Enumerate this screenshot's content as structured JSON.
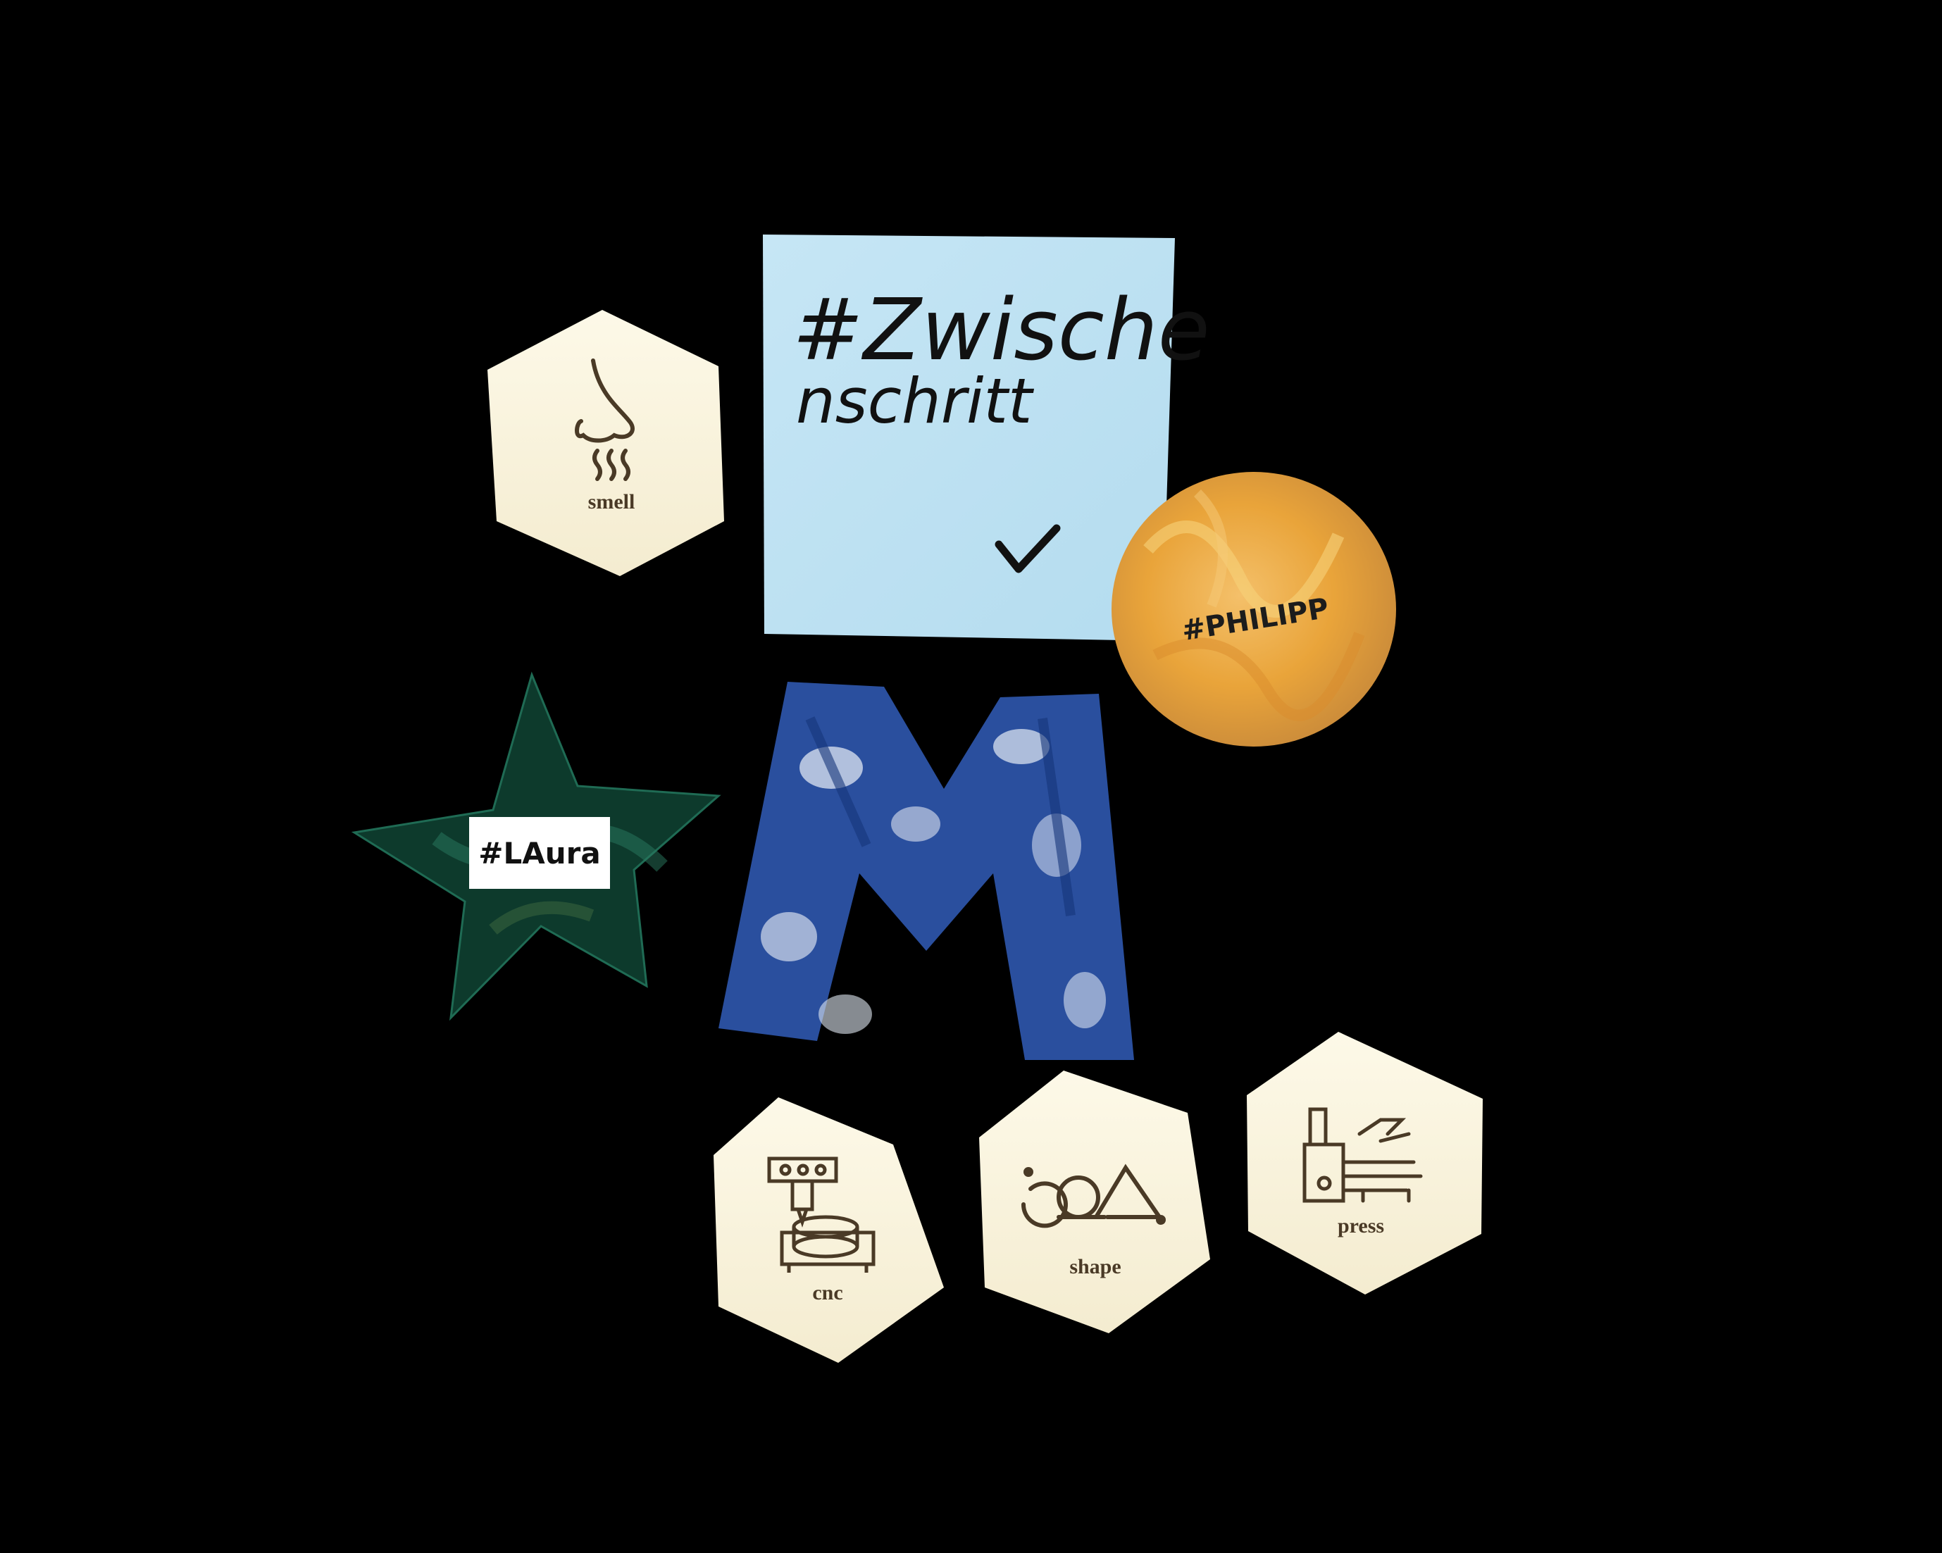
{
  "sticky_note": {
    "line1": "#Zwische",
    "line2": "nschritt",
    "mark": "✓"
  },
  "tiles": {
    "smell": "smell",
    "cnc": "cnc",
    "shape": "shape",
    "press": "press"
  },
  "tags": {
    "philipp": "#PHILIPP",
    "laura": "#LAura"
  },
  "colors": {
    "background": "#000000",
    "sticky_note": "#bfe2f2",
    "tile": "#fbf6e1",
    "engraving": "#4a3a26",
    "disc": "#e9a93c",
    "star": "#0d3a2c",
    "letter_m": "#2a4f9e"
  },
  "icons": [
    "nose-icon",
    "cnc-machine-icon",
    "shape-icon",
    "press-machine-icon",
    "checkmark-icon"
  ]
}
